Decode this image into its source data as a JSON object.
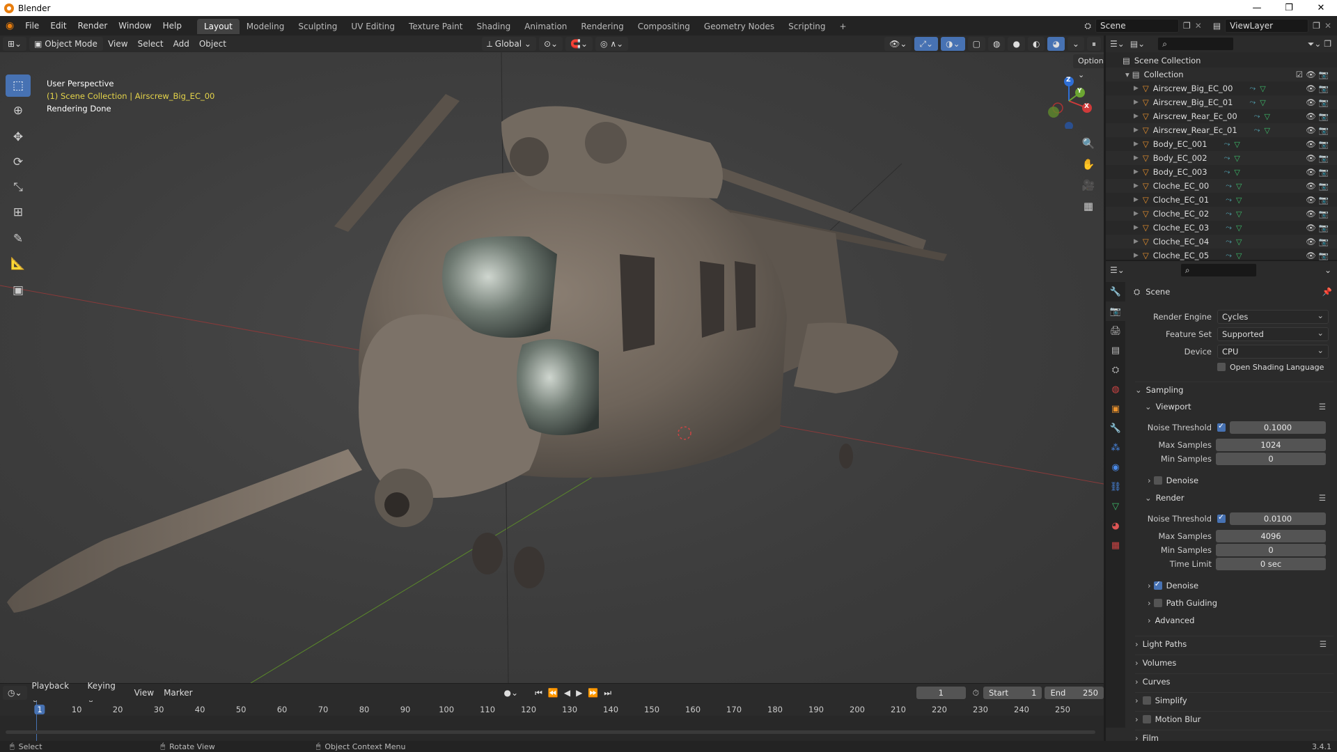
{
  "window": {
    "title": "Blender",
    "controls": [
      "—",
      "❐",
      "✕"
    ]
  },
  "menu": [
    "File",
    "Edit",
    "Render",
    "Window",
    "Help"
  ],
  "workspaces": [
    {
      "label": "Layout",
      "active": true
    },
    {
      "label": "Modeling"
    },
    {
      "label": "Sculpting"
    },
    {
      "label": "UV Editing"
    },
    {
      "label": "Texture Paint"
    },
    {
      "label": "Shading"
    },
    {
      "label": "Animation"
    },
    {
      "label": "Rendering"
    },
    {
      "label": "Compositing"
    },
    {
      "label": "Geometry Nodes"
    },
    {
      "label": "Scripting"
    }
  ],
  "add_workspace": "+",
  "scene": {
    "name": "Scene",
    "view_layer": "ViewLayer"
  },
  "viewport_header": {
    "mode": "Object Mode",
    "menus": [
      "View",
      "Select",
      "Add",
      "Object"
    ],
    "transform_orientation": "Global",
    "options": "Options"
  },
  "viewport_info": {
    "perspective": "User Perspective",
    "collection": "(1) Scene Collection | Airscrew_Big_EC_00",
    "status": "Rendering Done"
  },
  "gizmo": {
    "z": "Z",
    "y": "Y",
    "x": "X"
  },
  "outliner": {
    "root": "Scene Collection",
    "collection": "Collection",
    "items": [
      "Airscrew_Big_EC_00",
      "Airscrew_Big_EC_01",
      "Airscrew_Rear_Ec_00",
      "Airscrew_Rear_Ec_01",
      "Body_EC_001",
      "Body_EC_002",
      "Body_EC_003",
      "Cloche_EC_00",
      "Cloche_EC_01",
      "Cloche_EC_02",
      "Cloche_EC_03",
      "Cloche_EC_04",
      "Cloche_EC_05"
    ]
  },
  "properties": {
    "context": "Scene",
    "render_engine_label": "Render Engine",
    "render_engine": "Cycles",
    "feature_set_label": "Feature Set",
    "feature_set": "Supported",
    "device_label": "Device",
    "device": "CPU",
    "osl_label": "Open Shading Language",
    "sampling": "Sampling",
    "viewport": {
      "title": "Viewport",
      "noise_threshold_label": "Noise Threshold",
      "noise_threshold": "0.1000",
      "max_samples_label": "Max Samples",
      "max_samples": "1024",
      "min_samples_label": "Min Samples",
      "min_samples": "0",
      "denoise_label": "Denoise"
    },
    "render": {
      "title": "Render",
      "noise_threshold_label": "Noise Threshold",
      "noise_threshold": "0.0100",
      "max_samples_label": "Max Samples",
      "max_samples": "4096",
      "min_samples_label": "Min Samples",
      "min_samples": "0",
      "time_limit_label": "Time Limit",
      "time_limit": "0 sec",
      "denoise_label": "Denoise",
      "path_guiding_label": "Path Guiding",
      "advanced_label": "Advanced"
    },
    "panels": [
      "Light Paths",
      "Volumes",
      "Curves",
      "Simplify",
      "Motion Blur",
      "Film"
    ]
  },
  "timeline": {
    "menus": [
      "Playback",
      "Keying",
      "View",
      "Marker"
    ],
    "current_frame": "1",
    "start_label": "Start",
    "start": "1",
    "end_label": "End",
    "end": "250",
    "ticks": [
      "1",
      "10",
      "20",
      "30",
      "40",
      "50",
      "60",
      "70",
      "80",
      "90",
      "100",
      "110",
      "120",
      "130",
      "140",
      "150",
      "160",
      "170",
      "180",
      "190",
      "200",
      "210",
      "220",
      "230",
      "240",
      "250"
    ]
  },
  "statusbar": {
    "select": "Select",
    "rotate": "Rotate View",
    "context_menu": "Object Context Menu",
    "version": "3.4.1"
  }
}
